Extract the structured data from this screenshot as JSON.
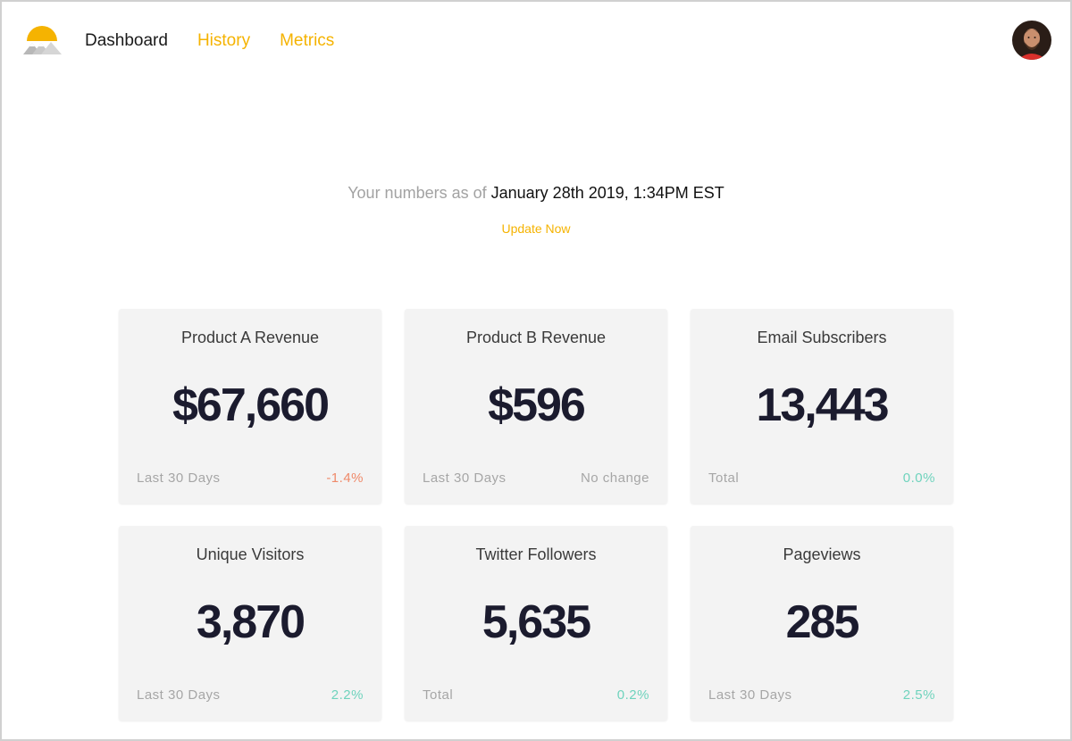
{
  "colors": {
    "accent": "#f5b301",
    "negative": "#ef8a6a",
    "positive": "#6fd3bd",
    "neutral": "#a6a6a6"
  },
  "header": {
    "logo_icon": "mountain-sun-logo-icon",
    "nav": [
      {
        "label": "Dashboard",
        "active": true
      },
      {
        "label": "History",
        "active": false
      },
      {
        "label": "Metrics",
        "active": false
      }
    ],
    "avatar_icon": "user-avatar-icon"
  },
  "status": {
    "prefix": "Your numbers as of",
    "timestamp": "January 28th 2019, 1:34PM EST",
    "update_label": "Update Now"
  },
  "cards": [
    {
      "title": "Product A Revenue",
      "value": "$67,660",
      "period": "Last 30 Days",
      "change": "-1.4%",
      "trend": "negative"
    },
    {
      "title": "Product B Revenue",
      "value": "$596",
      "period": "Last 30 Days",
      "change": "No change",
      "trend": "neutral"
    },
    {
      "title": "Email Subscribers",
      "value": "13,443",
      "period": "Total",
      "change": "0.0%",
      "trend": "positive"
    },
    {
      "title": "Unique Visitors",
      "value": "3,870",
      "period": "Last 30 Days",
      "change": "2.2%",
      "trend": "positive"
    },
    {
      "title": "Twitter Followers",
      "value": "5,635",
      "period": "Total",
      "change": "0.2%",
      "trend": "positive"
    },
    {
      "title": "Pageviews",
      "value": "285",
      "period": "Last 30 Days",
      "change": "2.5%",
      "trend": "positive"
    }
  ]
}
